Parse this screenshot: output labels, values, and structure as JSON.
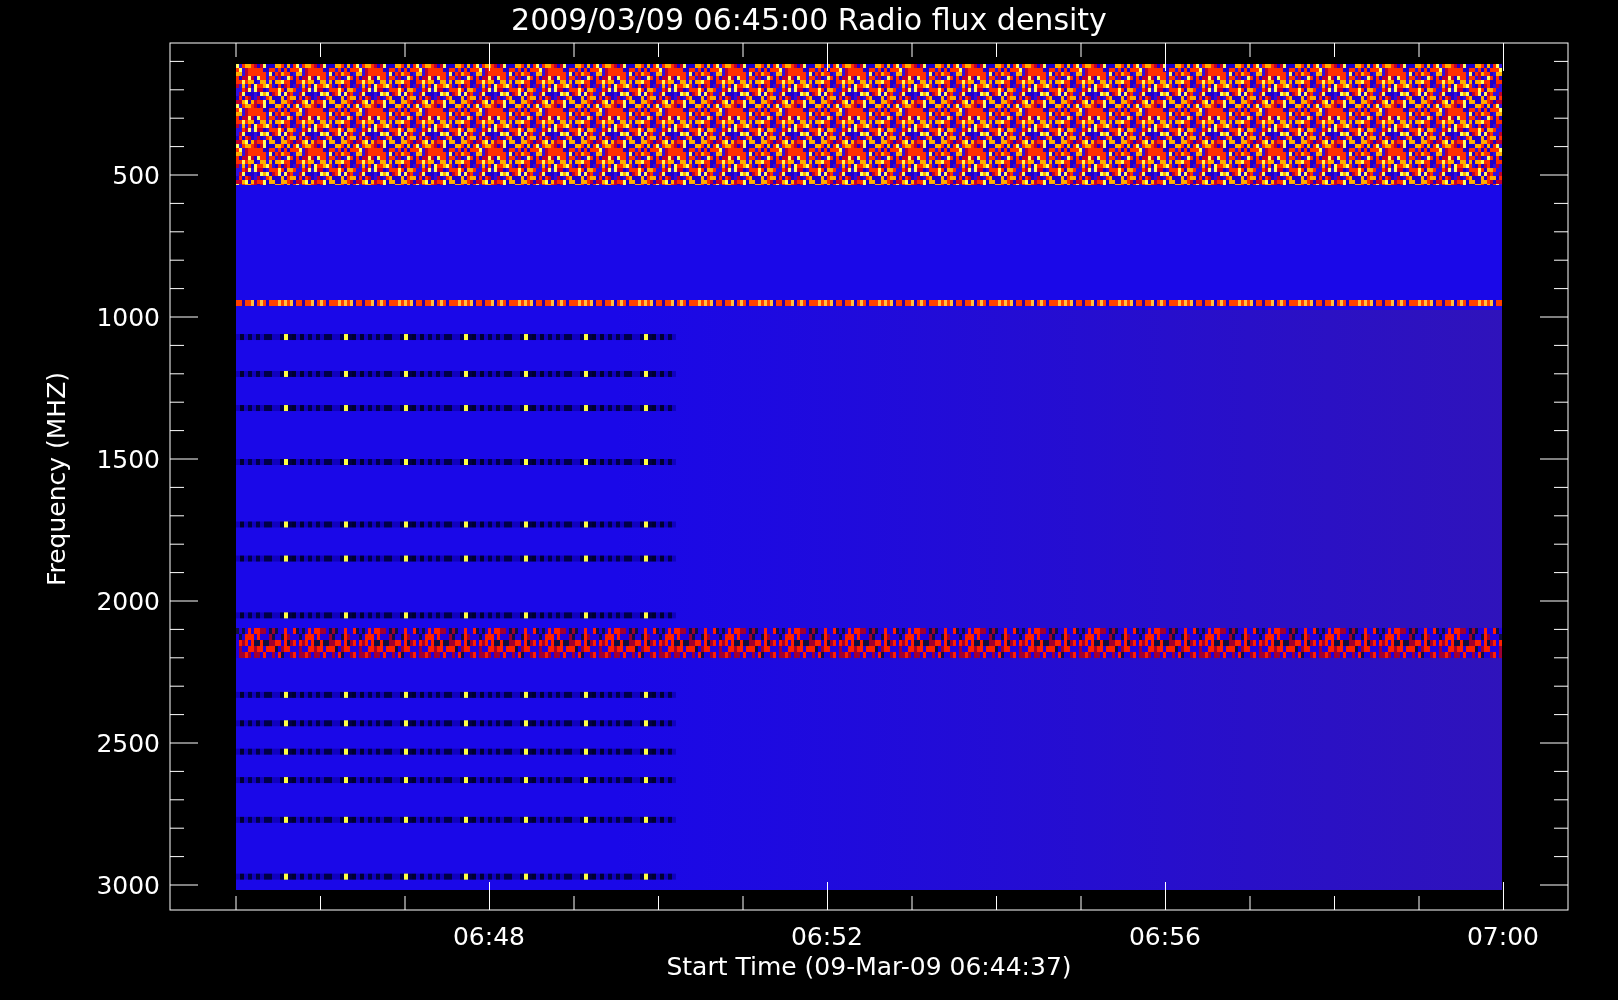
{
  "title": "2009/03/09 06:45:00 Radio flux density",
  "y_axis": {
    "label": "Frequency (MHZ)",
    "ticks": [
      "500",
      "1000",
      "1500",
      "2000",
      "2500",
      "3000"
    ]
  },
  "x_axis": {
    "label": "Start Time (09-Mar-09 06:44:37)",
    "ticks": [
      "06:48",
      "06:52",
      "06:56",
      "07:00"
    ]
  }
}
